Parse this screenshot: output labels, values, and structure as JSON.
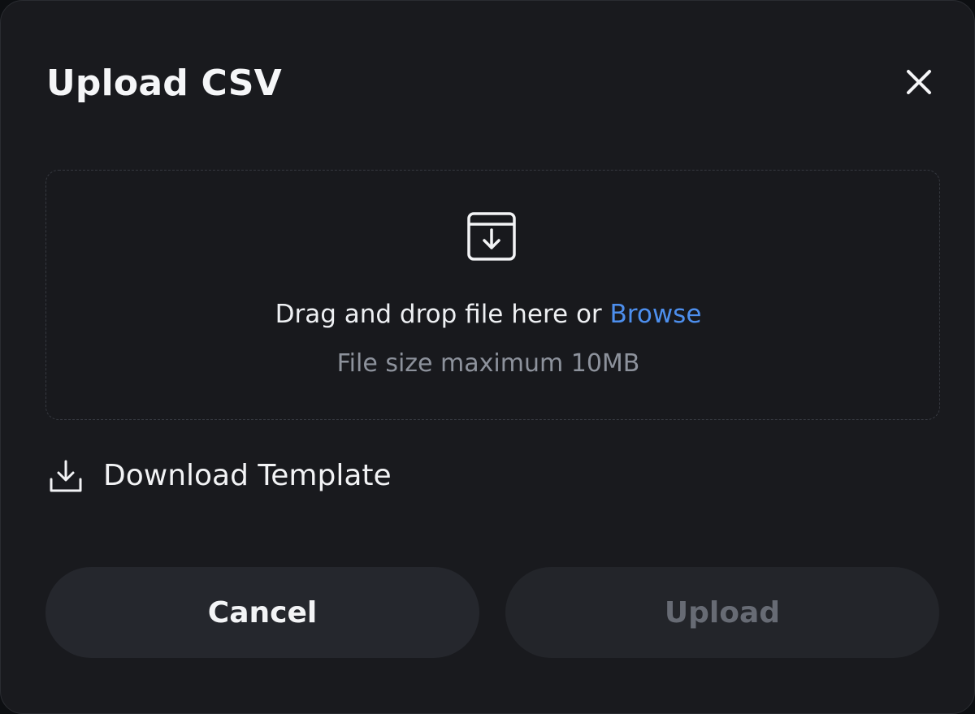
{
  "dialog": {
    "title": "Upload CSV",
    "close_icon": "close-icon"
  },
  "dropzone": {
    "icon": "archive-download-icon",
    "text": "Drag and drop file here or ",
    "browse_label": "Browse",
    "hint": "File size maximum 10MB"
  },
  "template": {
    "icon": "download-icon",
    "label": "Download Template"
  },
  "actions": {
    "cancel_label": "Cancel",
    "upload_label": "Upload",
    "upload_disabled": true
  },
  "colors": {
    "background": "#191a1e",
    "accent_link": "#4d8fee",
    "button_bg": "#25272d",
    "disabled_text": "#676b74"
  }
}
